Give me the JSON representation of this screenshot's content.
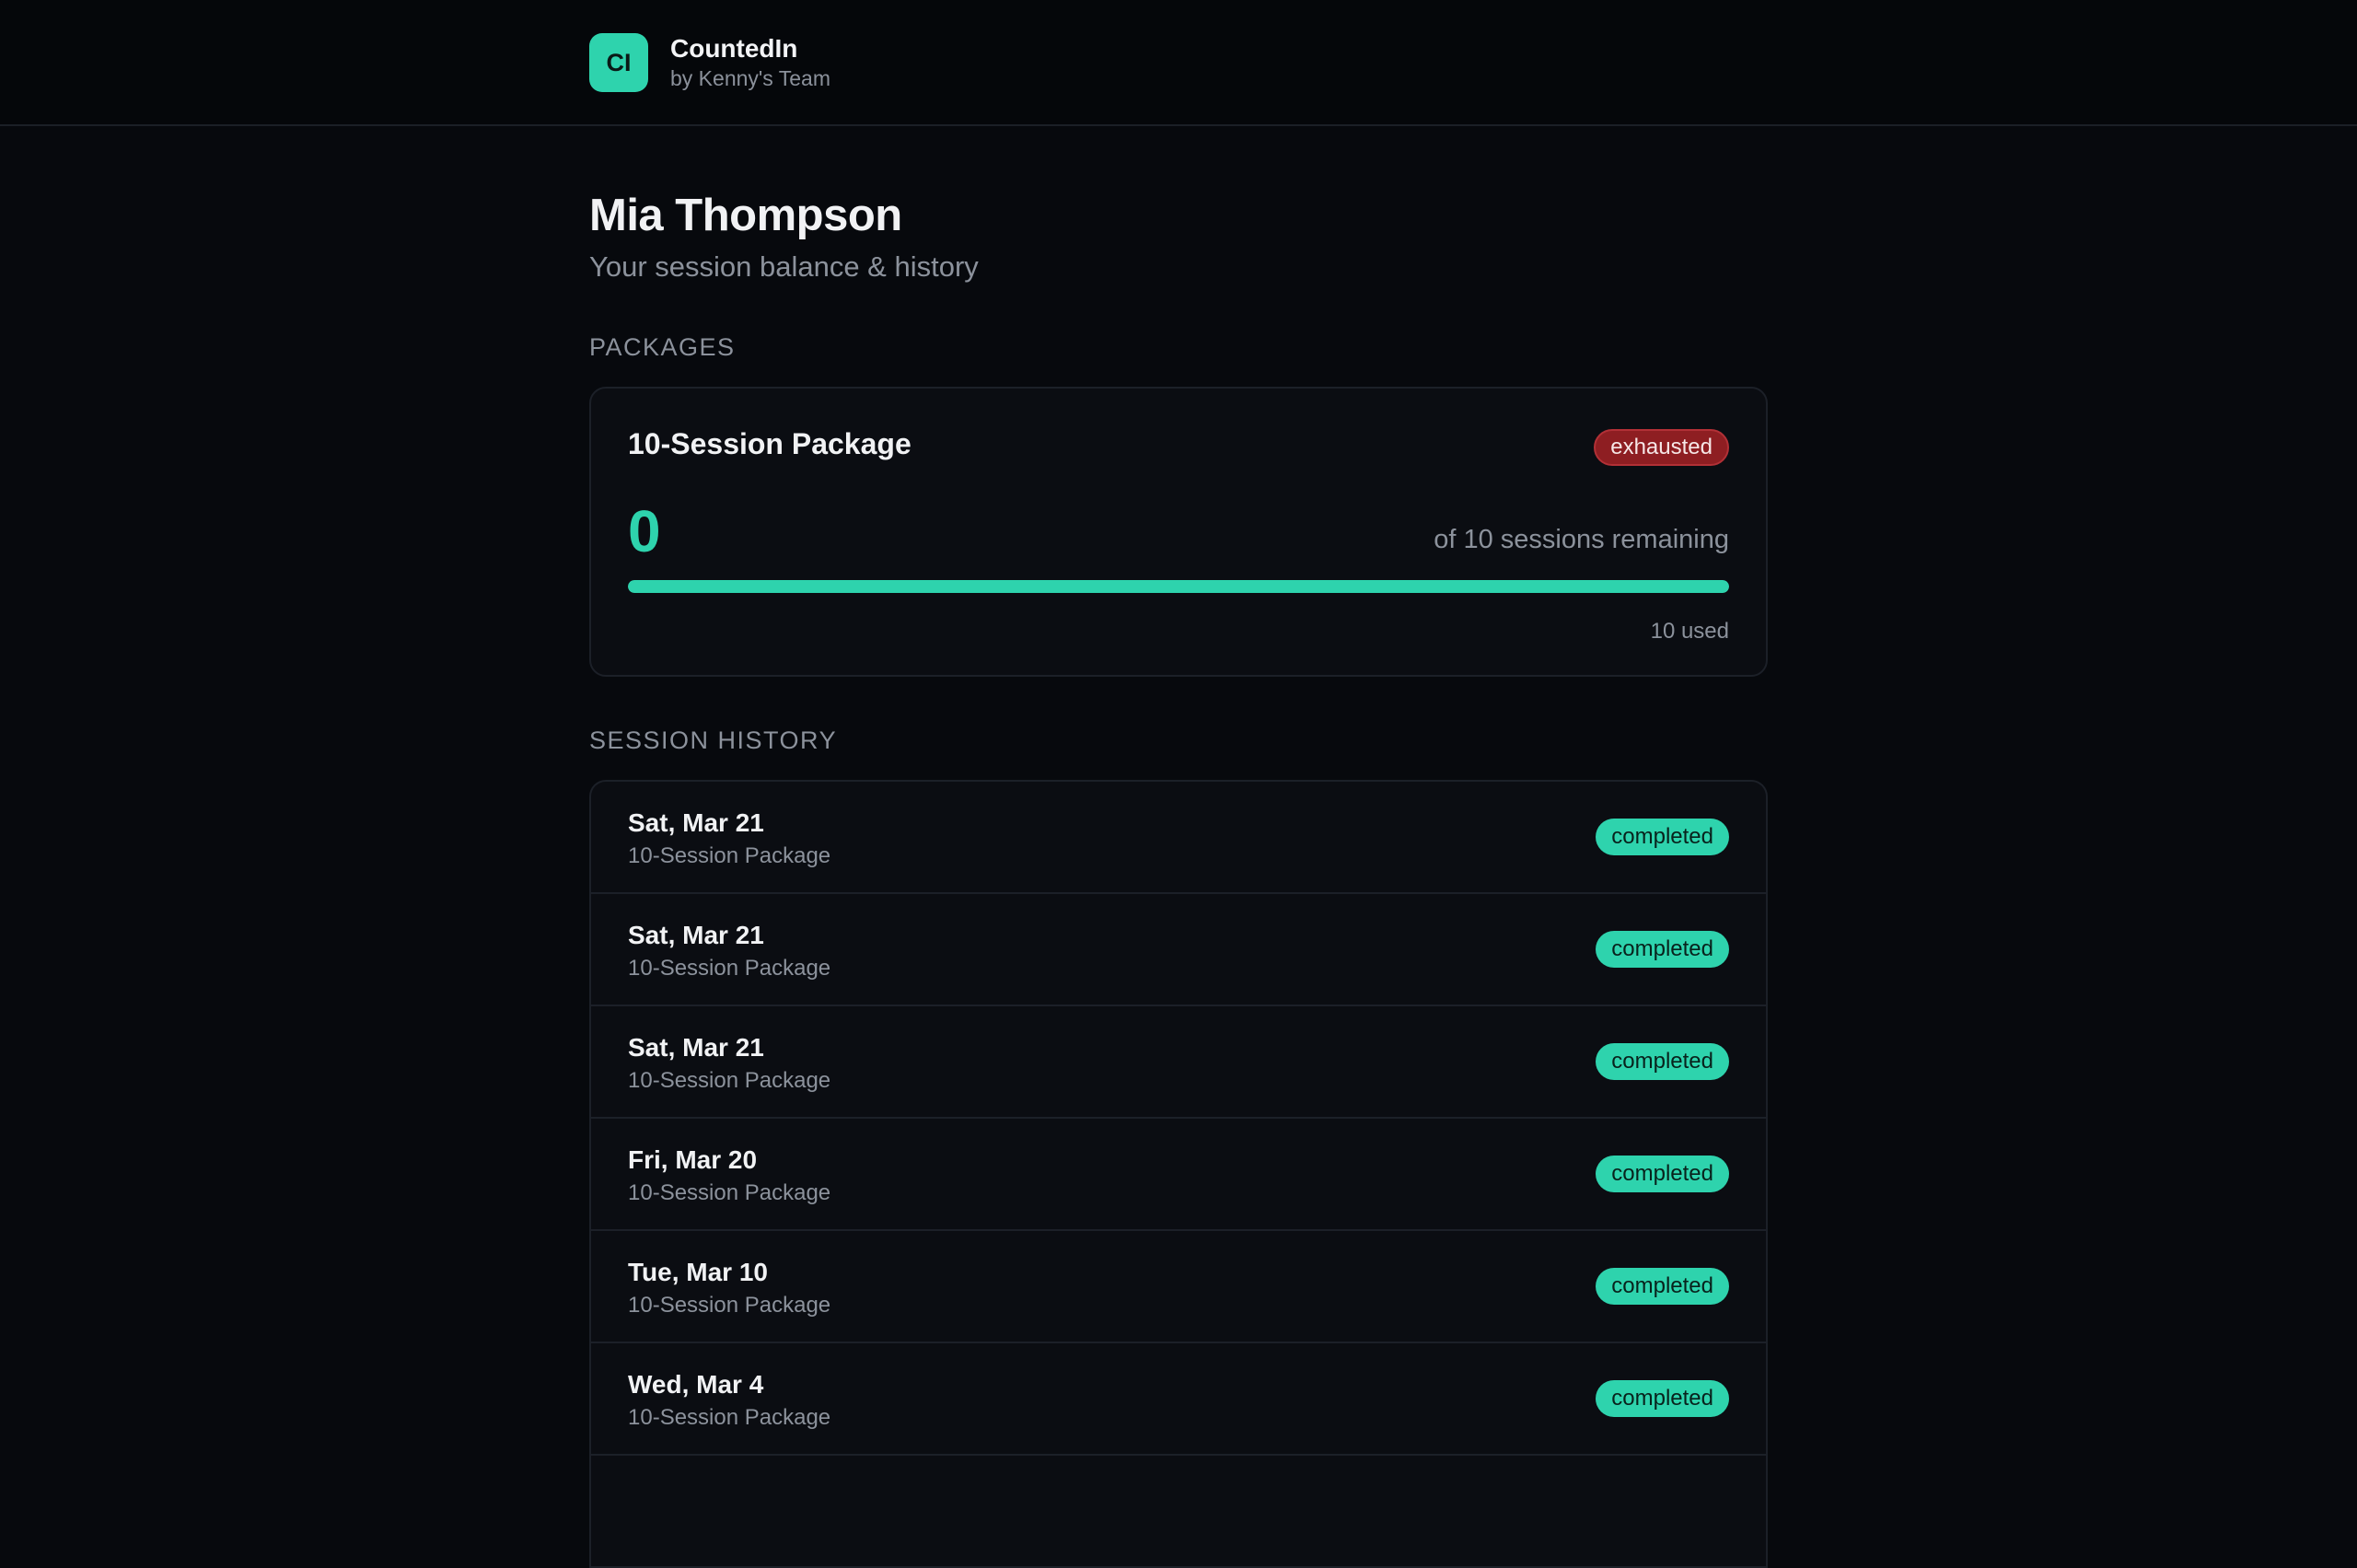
{
  "app": {
    "logo_initials": "CI",
    "name": "CountedIn",
    "byline": "by Kenny's Team",
    "accent_color": "#2ed3ad"
  },
  "page": {
    "title": "Mia Thompson",
    "subtitle": "Your session balance & history"
  },
  "packages_section": {
    "label": "PACKAGES",
    "package": {
      "name": "10-Session Package",
      "status": "exhausted",
      "status_color": "#8e1e22",
      "remaining": "0",
      "of_text": "of 10 sessions remaining",
      "used_text": "10 used",
      "used_fraction": 1.0
    }
  },
  "history_section": {
    "label": "SESSION HISTORY",
    "rows": [
      {
        "date": "Sat, Mar 21",
        "package": "10-Session Package",
        "status": "completed"
      },
      {
        "date": "Sat, Mar 21",
        "package": "10-Session Package",
        "status": "completed"
      },
      {
        "date": "Sat, Mar 21",
        "package": "10-Session Package",
        "status": "completed"
      },
      {
        "date": "Fri, Mar 20",
        "package": "10-Session Package",
        "status": "completed"
      },
      {
        "date": "Tue, Mar 10",
        "package": "10-Session Package",
        "status": "completed"
      },
      {
        "date": "Wed, Mar 4",
        "package": "10-Session Package",
        "status": "completed"
      },
      {
        "date": "",
        "package": "",
        "status": ""
      }
    ]
  }
}
